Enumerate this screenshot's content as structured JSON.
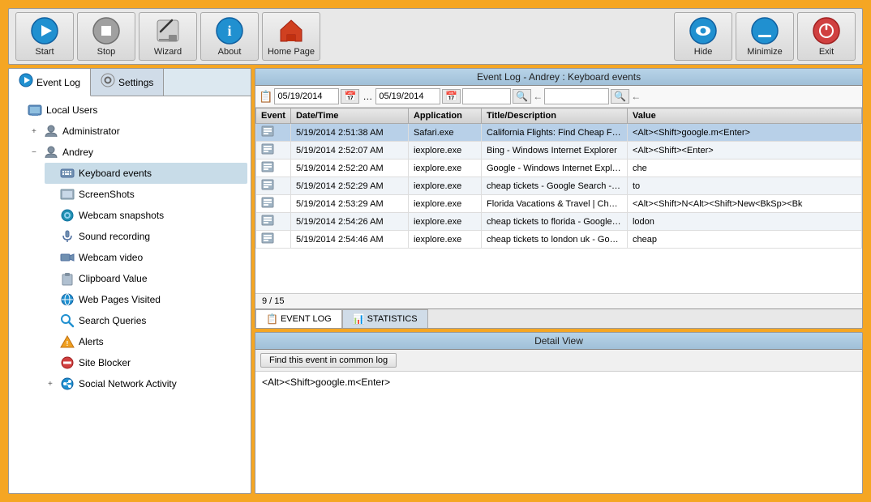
{
  "toolbar": {
    "title": "Event Log",
    "buttons_left": [
      {
        "id": "start",
        "label": "Start",
        "icon": "▶",
        "color": "#2090d0"
      },
      {
        "id": "stop",
        "label": "Stop",
        "icon": "⏹",
        "color": "#808080"
      },
      {
        "id": "wizard",
        "label": "Wizard",
        "icon": "✏️",
        "color": "#606060"
      },
      {
        "id": "about",
        "label": "About",
        "icon": "ℹ️",
        "color": "#2080c0"
      },
      {
        "id": "homepage",
        "label": "Home Page",
        "icon": "🏠",
        "color": "#e05020"
      }
    ],
    "buttons_right": [
      {
        "id": "hide",
        "label": "Hide",
        "icon": "👁",
        "color": "#2090d0"
      },
      {
        "id": "minimize",
        "label": "Minimize",
        "icon": "🔵",
        "color": "#2090d0"
      },
      {
        "id": "exit",
        "label": "Exit",
        "icon": "⏻",
        "color": "#d04040"
      }
    ]
  },
  "left_panel": {
    "tabs": [
      {
        "id": "eventlog",
        "label": "Event Log",
        "active": true
      },
      {
        "id": "settings",
        "label": "Settings",
        "active": false
      }
    ],
    "tree": [
      {
        "id": "local-users",
        "label": "Local Users",
        "indent": 0,
        "expand": "",
        "icon": "🖥"
      },
      {
        "id": "administrator",
        "label": "Administrator",
        "indent": 1,
        "expand": "+",
        "icon": "👤"
      },
      {
        "id": "andrey",
        "label": "Andrey",
        "indent": 1,
        "expand": "−",
        "icon": "👤"
      },
      {
        "id": "keyboard-events",
        "label": "Keyboard events",
        "indent": 2,
        "expand": "",
        "icon": "⌨",
        "selected": true
      },
      {
        "id": "screenshots",
        "label": "ScreenShots",
        "indent": 2,
        "expand": "",
        "icon": "🖼"
      },
      {
        "id": "webcam-snapshots",
        "label": "Webcam snapshots",
        "indent": 2,
        "expand": "",
        "icon": "📷"
      },
      {
        "id": "sound-recording",
        "label": "Sound recording",
        "indent": 2,
        "expand": "",
        "icon": "🎤"
      },
      {
        "id": "webcam-video",
        "label": "Webcam video",
        "indent": 2,
        "expand": "",
        "icon": "📹"
      },
      {
        "id": "clipboard-value",
        "label": "Clipboard Value",
        "indent": 2,
        "expand": "",
        "icon": "📋"
      },
      {
        "id": "web-pages-visited",
        "label": "Web Pages Visited",
        "indent": 2,
        "expand": "",
        "icon": "🌐"
      },
      {
        "id": "search-queries",
        "label": "Search Queries",
        "indent": 2,
        "expand": "",
        "icon": "🔍"
      },
      {
        "id": "alerts",
        "label": "Alerts",
        "indent": 2,
        "expand": "",
        "icon": "⚠"
      },
      {
        "id": "site-blocker",
        "label": "Site Blocker",
        "indent": 2,
        "expand": "",
        "icon": "🚫"
      },
      {
        "id": "social-network",
        "label": "Social Network Activity",
        "indent": 2,
        "expand": "+",
        "icon": "👥"
      }
    ]
  },
  "event_log": {
    "title": "Event Log - Andrey : Keyboard events",
    "columns": [
      "Event",
      "Date/Time",
      "Application",
      "Title/Description",
      "Value"
    ],
    "date_from": "05/19/2014",
    "date_to": "05/19/2014",
    "rows": [
      {
        "event": "⌨",
        "datetime": "5/19/2014 2:51:38 AM",
        "application": "Safari.exe",
        "title": "California Flights: Find Cheap Fligh",
        "value": "<Alt><Shift>google.m<Enter>",
        "selected": true
      },
      {
        "event": "⌨",
        "datetime": "5/19/2014 2:52:07 AM",
        "application": "iexplore.exe",
        "title": "Bing - Windows Internet Explorer",
        "value": "<Alt><Shift><Enter>"
      },
      {
        "event": "⌨",
        "datetime": "5/19/2014 2:52:20 AM",
        "application": "iexplore.exe",
        "title": "Google - Windows Internet Explore",
        "value": "che"
      },
      {
        "event": "⌨",
        "datetime": "5/19/2014 2:52:29 AM",
        "application": "iexplore.exe",
        "title": "cheap tickets - Google Search - Win",
        "value": "to"
      },
      {
        "event": "⌨",
        "datetime": "5/19/2014 2:53:29 AM",
        "application": "iexplore.exe",
        "title": "Florida Vacations & Travel | Cheap",
        "value": "<Alt><Shift>N<Alt><Shift>New<BkSp><Bk"
      },
      {
        "event": "⌨",
        "datetime": "5/19/2014 2:54:26 AM",
        "application": "iexplore.exe",
        "title": "cheap tickets to florida - Google Se",
        "value": "lodon"
      },
      {
        "event": "⌨",
        "datetime": "5/19/2014 2:54:46 AM",
        "application": "iexplore.exe",
        "title": "cheap tickets to london uk - Google",
        "value": "cheap"
      }
    ],
    "pagination": "9 / 15",
    "bottom_tabs": [
      {
        "id": "event-log-tab",
        "label": "EVENT LOG",
        "icon": "📋",
        "active": true
      },
      {
        "id": "statistics-tab",
        "label": "STATISTICS",
        "icon": "📊",
        "active": false
      }
    ]
  },
  "detail_view": {
    "title": "Detail View",
    "action_button": "Find this event in common log",
    "content": "<Alt><Shift>google.m<Enter>"
  }
}
